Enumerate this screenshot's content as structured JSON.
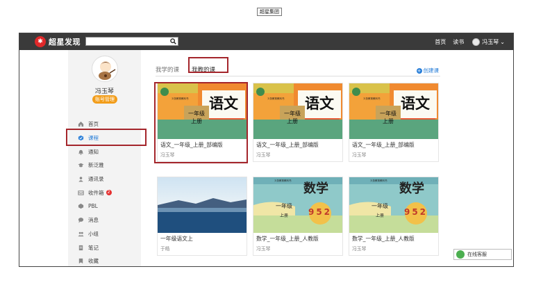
{
  "brand": {
    "name": "超星发现"
  },
  "search": {
    "placeholder": ""
  },
  "tooltip": "超星集团",
  "topnav": {
    "home": "首页",
    "read": "读书",
    "user": "冯玉琴",
    "dropdown": "⌄"
  },
  "profile": {
    "name": "冯玉琴",
    "account_button": "账号管理"
  },
  "sidebar": {
    "items": [
      {
        "label": "首页",
        "icon": "home-icon"
      },
      {
        "label": "课程",
        "icon": "course-icon"
      },
      {
        "label": "通知",
        "icon": "bell-icon"
      },
      {
        "label": "新泛雅",
        "icon": "cap-icon"
      },
      {
        "label": "通讯录",
        "icon": "contacts-icon"
      },
      {
        "label": "收件箱",
        "icon": "inbox-icon",
        "badge": "2"
      },
      {
        "label": "PBL",
        "icon": "pbl-icon"
      },
      {
        "label": "消息",
        "icon": "message-icon"
      },
      {
        "label": "小组",
        "icon": "group-icon"
      },
      {
        "label": "笔记",
        "icon": "note-icon"
      },
      {
        "label": "收藏",
        "icon": "bookmark-icon"
      }
    ],
    "active_index": 1
  },
  "tabs": {
    "mine": "我学的课",
    "teach": "我教的课"
  },
  "create_label": "创建课",
  "courses": [
    {
      "title": "语文_一年级_上册_部编版",
      "teacher": "冯玉琴",
      "cover_type": "yuwen"
    },
    {
      "title": "语文_一年级_上册_部编版",
      "teacher": "冯玉琴",
      "cover_type": "yuwen"
    },
    {
      "title": "语文_一年级_上册_部编版",
      "teacher": "冯玉琴",
      "cover_type": "yuwen"
    },
    {
      "title": "一年级语文上",
      "teacher": "于皓",
      "cover_type": "photo"
    },
    {
      "title": "数学_一年级_上册_人教版",
      "teacher": "冯玉琴",
      "cover_type": "shuxue"
    },
    {
      "title": "数学_一年级_上册_人教版",
      "teacher": "冯玉琴",
      "cover_type": "shuxue"
    }
  ],
  "covers": {
    "yuwen": {
      "big": "语文",
      "grade": "一年级",
      "term": "上册",
      "series": "义务教育教科书"
    },
    "shuxue": {
      "big": "数学",
      "grade": "一年级",
      "term": "上册",
      "series": "义务教育教科书",
      "nums": "952"
    }
  },
  "help": {
    "label": "在线客服"
  },
  "colors": {
    "topbar": "#3a3a3a",
    "accent": "#2a7fd8",
    "highlight": "#a4252b",
    "badge": "#e53030",
    "account": "#f29d1a"
  }
}
